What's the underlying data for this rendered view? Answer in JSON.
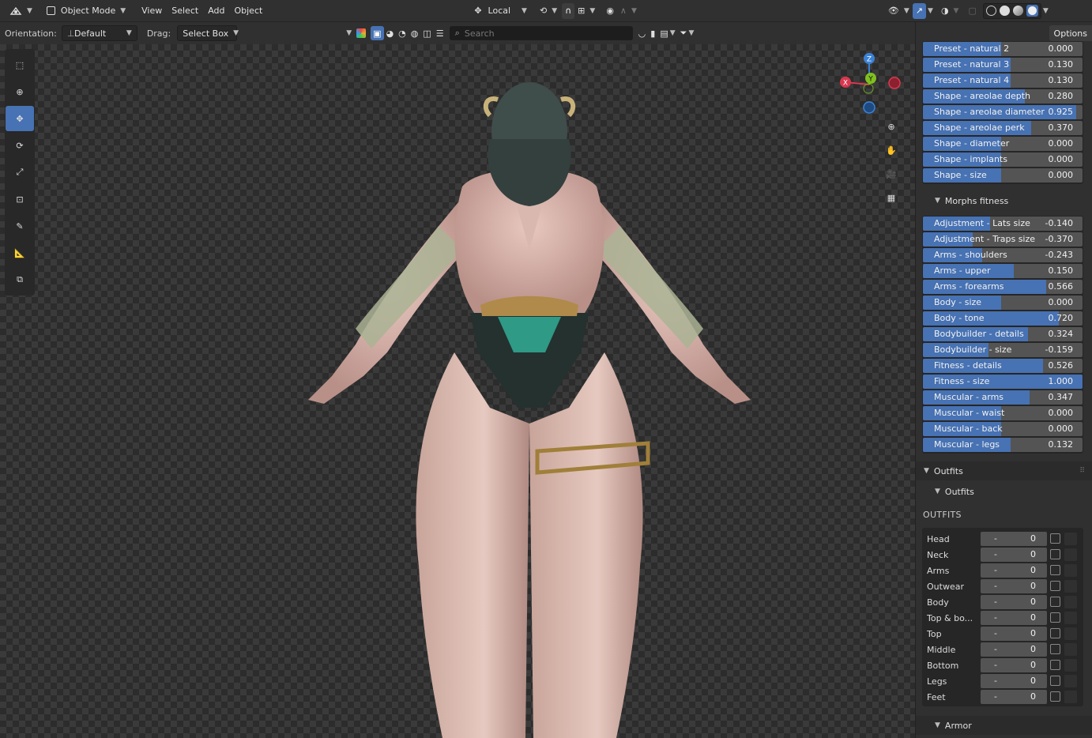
{
  "header": {
    "mode": "Object Mode",
    "menus": [
      "View",
      "Select",
      "Add",
      "Object"
    ],
    "transform_space": "Local"
  },
  "toolbar": {
    "orientation_label": "Orientation:",
    "orientation_value": "Default",
    "drag_label": "Drag:",
    "drag_value": "Select Box",
    "search_placeholder": "Search",
    "options_label": "Options"
  },
  "gizmo": {
    "x": "X",
    "y": "Y",
    "z": "Z"
  },
  "colors": {
    "accent": "#4772b3",
    "axis_x": "#d9384e",
    "axis_y": "#80bf1f",
    "axis_z": "#3b82d6"
  },
  "morphs_top": [
    {
      "label": "Preset - natural 2",
      "value": "0.000",
      "fraction": 0.49
    },
    {
      "label": "Preset - natural 3",
      "value": "0.130",
      "fraction": 0.55
    },
    {
      "label": "Preset - natural 4",
      "value": "0.130",
      "fraction": 0.55
    },
    {
      "label": "Shape - areolae depth",
      "value": "0.280",
      "fraction": 0.64
    },
    {
      "label": "Shape - areolae diameter",
      "value": "0.925",
      "fraction": 0.96
    },
    {
      "label": "Shape - areolae perk",
      "value": "0.370",
      "fraction": 0.68
    },
    {
      "label": "Shape - diameter",
      "value": "0.000",
      "fraction": 0.49
    },
    {
      "label": "Shape - implants",
      "value": "0.000",
      "fraction": 0.49
    },
    {
      "label": "Shape - size",
      "value": "0.000",
      "fraction": 0.49
    }
  ],
  "fitness_header": "Morphs fitness",
  "morphs_fitness": [
    {
      "label": "Adjustment - Lats size",
      "value": "-0.140",
      "fraction": 0.42
    },
    {
      "label": "Adjustment - Traps size",
      "value": "-0.370",
      "fraction": 0.31
    },
    {
      "label": "Arms - shoulders",
      "value": "-0.243",
      "fraction": 0.37
    },
    {
      "label": "Arms - upper",
      "value": "0.150",
      "fraction": 0.57
    },
    {
      "label": "Arms - forearms",
      "value": "0.566",
      "fraction": 0.77
    },
    {
      "label": "Body - size",
      "value": "0.000",
      "fraction": 0.49
    },
    {
      "label": "Body - tone",
      "value": "0.720",
      "fraction": 0.85
    },
    {
      "label": "Bodybuilder - details",
      "value": "0.324",
      "fraction": 0.66
    },
    {
      "label": "Bodybuilder - size",
      "value": "-0.159",
      "fraction": 0.41
    },
    {
      "label": "Fitness - details",
      "value": "0.526",
      "fraction": 0.75
    },
    {
      "label": "Fitness - size",
      "value": "1.000",
      "fraction": 1.0
    },
    {
      "label": "Muscular - arms",
      "value": "0.347",
      "fraction": 0.67
    },
    {
      "label": "Muscular - waist",
      "value": "0.000",
      "fraction": 0.49
    },
    {
      "label": "Muscular - back",
      "value": "0.000",
      "fraction": 0.49
    },
    {
      "label": "Muscular - legs",
      "value": "0.132",
      "fraction": 0.55
    }
  ],
  "outfits_panel": "Outfits",
  "outfits_sub": "Outfits",
  "outfits_caption": "OUTFITS",
  "outfit_rows": [
    {
      "label": "Head",
      "minus": "-",
      "value": "0"
    },
    {
      "label": "Neck",
      "minus": "-",
      "value": "0"
    },
    {
      "label": "Arms",
      "minus": "-",
      "value": "0"
    },
    {
      "label": "Outwear",
      "minus": "-",
      "value": "0"
    },
    {
      "label": "Body",
      "minus": "-",
      "value": "0"
    },
    {
      "label": "Top & bo...",
      "minus": "-",
      "value": "0"
    },
    {
      "label": "Top",
      "minus": "-",
      "value": "0"
    },
    {
      "label": "Middle",
      "minus": "-",
      "value": "0"
    },
    {
      "label": "Bottom",
      "minus": "-",
      "value": "0"
    },
    {
      "label": "Legs",
      "minus": "-",
      "value": "0"
    },
    {
      "label": "Feet",
      "minus": "-",
      "value": "0"
    }
  ],
  "armor_header": "Armor"
}
